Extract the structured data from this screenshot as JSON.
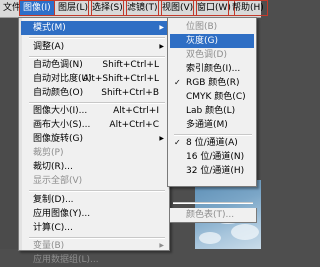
{
  "menubar": {
    "items": [
      {
        "label": "文件(F)"
      },
      {
        "label": "图像(I)"
      },
      {
        "label": "图层(L)"
      },
      {
        "label": "选择(S)"
      },
      {
        "label": "滤镜(T)"
      },
      {
        "label": "视图(V)"
      },
      {
        "label": "窗口(W)"
      },
      {
        "label": "帮助(H)"
      }
    ]
  },
  "image_menu": {
    "mode": {
      "label": "模式(M)"
    },
    "adjust": {
      "label": "调整(A)"
    },
    "auto_tone": {
      "label": "自动色调(N)",
      "shortcut": "Shift+Ctrl+L"
    },
    "auto_contrast": {
      "label": "自动对比度(U)",
      "shortcut": "Alt+Shift+Ctrl+L"
    },
    "auto_color": {
      "label": "自动颜色(O)",
      "shortcut": "Shift+Ctrl+B"
    },
    "image_size": {
      "label": "图像大小(I)...",
      "shortcut": "Alt+Ctrl+I"
    },
    "canvas_size": {
      "label": "画布大小(S)...",
      "shortcut": "Alt+Ctrl+C"
    },
    "rotate": {
      "label": "图像旋转(G)"
    },
    "crop": {
      "label": "裁剪(P)"
    },
    "trim": {
      "label": "裁切(R)..."
    },
    "reveal_all": {
      "label": "显示全部(V)"
    },
    "duplicate": {
      "label": "复制(D)..."
    },
    "apply_image": {
      "label": "应用图像(Y)..."
    },
    "calculations": {
      "label": "计算(C)..."
    },
    "variables": {
      "label": "变量(B)"
    },
    "apply_dataset": {
      "label": "应用数据组(L)..."
    }
  },
  "mode_submenu": {
    "bitmap": {
      "label": "位图(B)"
    },
    "grayscale": {
      "label": "灰度(G)"
    },
    "duotone": {
      "label": "双色调(D)"
    },
    "indexed": {
      "label": "索引颜色(I)..."
    },
    "rgb": {
      "label": "RGB 颜色(R)",
      "check": "✓"
    },
    "cmyk": {
      "label": "CMYK 颜色(C)"
    },
    "lab": {
      "label": "Lab 颜色(L)"
    },
    "multichannel": {
      "label": "多通道(M)"
    },
    "bits8": {
      "label": "8 位/通道(A)",
      "check": "✓"
    },
    "bits16": {
      "label": "16 位/通道(N)"
    },
    "bits32": {
      "label": "32 位/通道(H)"
    },
    "color_table": {
      "label": "颜色表(T)..."
    }
  }
}
